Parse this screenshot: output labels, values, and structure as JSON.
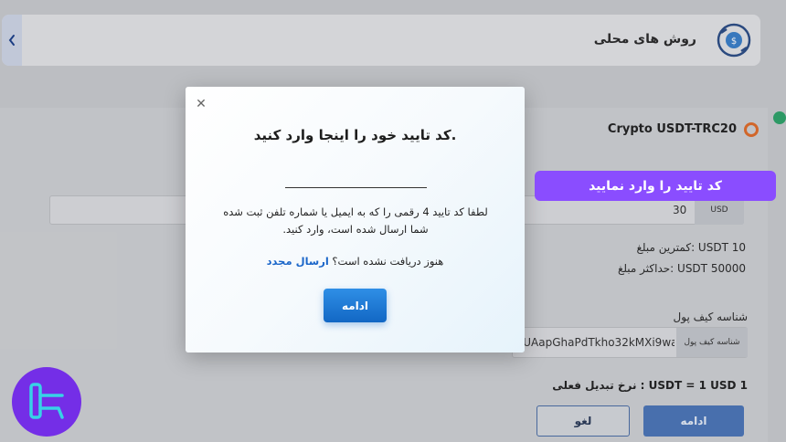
{
  "header": {
    "title": "روش های محلی",
    "back_icon": "chevron-left-icon",
    "method_icon": "currency-exchange-icon"
  },
  "crypto": {
    "title": "Crypto USDT-TRC20"
  },
  "amount": {
    "value": "30",
    "unit": "USD"
  },
  "limits": {
    "min": "کمترین مبلغ: USDT 10",
    "max": "حداکثر مبلغ: USDT 50000"
  },
  "wallet": {
    "label": "شناسه کیف پول",
    "value": "sUAapGhaPdTkho32kMXi9wa",
    "tag": "شناسه کیف پول"
  },
  "rate": {
    "label": "نرخ تبدیل فعلی : USDT = 1 USD 1"
  },
  "form_buttons": {
    "cancel": "لغو",
    "continue": "ادامه"
  },
  "tooltip": {
    "text": "کد تایید را وارد نمایید"
  },
  "modal": {
    "title": "کد تایید خود را اینجا وارد کنید.",
    "description": "لطفا کد تایید 4 رقمی را که به ایمیل یا شماره تلفن ثبت شده شما ارسال شده است، وارد کنید.",
    "resend_prompt": "هنوز دریافت نشده است؟",
    "resend_link": "ارسال مجدد",
    "continue_button": "ادامه",
    "close_icon": "close-icon"
  },
  "colors": {
    "accent": "#1267c4",
    "tooltip": "#8a4dff",
    "logo": "#7b2ff7"
  }
}
